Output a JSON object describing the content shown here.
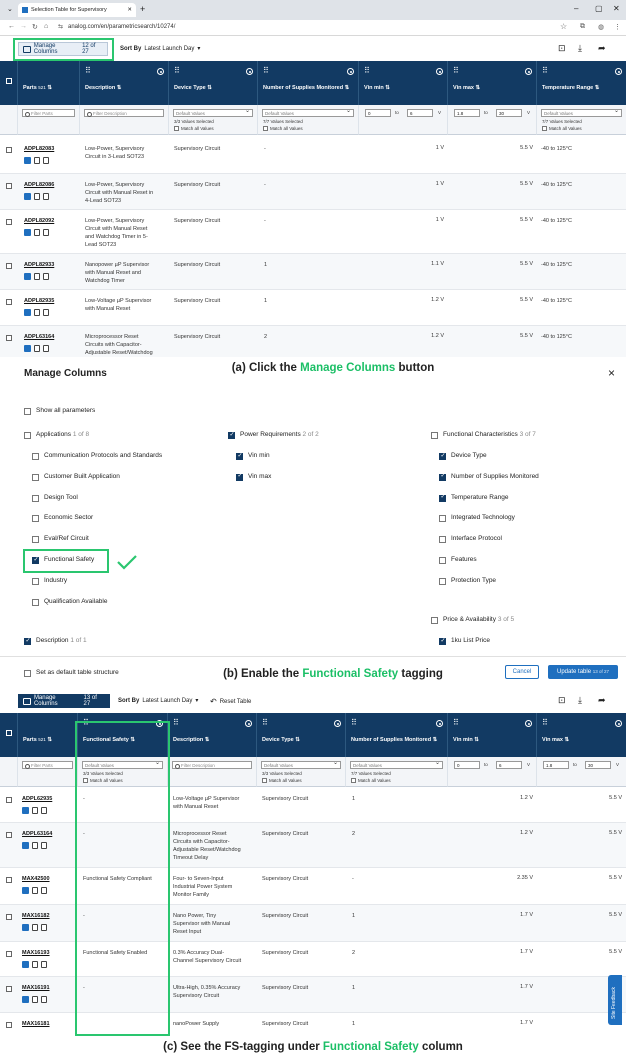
{
  "browser": {
    "tab_title": "Selection Table for Supervisory",
    "url": "analog.com/en/parametricsearch/10274/",
    "win_controls": [
      "–",
      "▢",
      "✕"
    ]
  },
  "panel_a": {
    "toolbar": {
      "manage_label": "Manage Columns",
      "manage_count": "12 of 27",
      "sort_label": "Sort By",
      "sort_value": "Latest Launch Day"
    },
    "headers": {
      "parts": "Parts",
      "parts_count": "521",
      "description": "Description",
      "device_type": "Device Type",
      "supplies": "Number of Supplies Monitored",
      "vin_min": "Vin min",
      "vin_max": "Vin max",
      "temp": "Temperature Range"
    },
    "filters": {
      "parts_ph": "Filter Parts",
      "desc_ph": "Filter Description",
      "default_values": "Default Values",
      "dev_sub": "3/3 Values Selected",
      "sup_sub": "7/7 Values Selected",
      "temp_sub": "7/7 Values Selected",
      "match_all": "Match all Values",
      "vmin_lo": "0",
      "vmin_hi": "6",
      "vmax_lo": "1.8",
      "vmax_hi": "30",
      "to": "to",
      "unit": "V"
    },
    "rows": [
      {
        "part": "ADPL82083",
        "desc": [
          "Low-Power, Supervisory",
          "Circuit in 3-Lead SOT23"
        ],
        "type": "Supervisory Circuit",
        "sup": "-",
        "vmin": "1 V",
        "vmax": "5.5 V",
        "temp": "-40 to 125°C"
      },
      {
        "part": "ADPL82086",
        "desc": [
          "Low-Power, Supervisory",
          "Circuit with Manual Reset in",
          "4-Lead SOT23"
        ],
        "type": "Supervisory Circuit",
        "sup": "-",
        "vmin": "1 V",
        "vmax": "5.5 V",
        "temp": "-40 to 125°C"
      },
      {
        "part": "ADPL82092",
        "desc": [
          "Low-Power, Supervisory",
          "Circuit with Manual Reset",
          "and Watchdog Timer in 5-",
          "Lead SOT23"
        ],
        "type": "Supervisory Circuit",
        "sup": "-",
        "vmin": "1 V",
        "vmax": "5.5 V",
        "temp": "-40 to 125°C"
      },
      {
        "part": "ADPL82933",
        "desc": [
          "Nanopower µP Supervisor",
          "with Manual Reset and",
          "Watchdog Timer"
        ],
        "type": "Supervisory Circuit",
        "sup": "1",
        "vmin": "1.1 V",
        "vmax": "5.5 V",
        "temp": "-40 to 125°C"
      },
      {
        "part": "ADPL82935",
        "desc": [
          "Low-Voltage µP Supervisor",
          "with Manual Reset"
        ],
        "type": "Supervisory Circuit",
        "sup": "1",
        "vmin": "1.2 V",
        "vmax": "5.5 V",
        "temp": "-40 to 125°C"
      },
      {
        "part": "ADPL63164",
        "desc": [
          "Microprocessor Reset",
          "Circuits with Capacitor-",
          "Adjustable Reset/Watchdog"
        ],
        "type": "Supervisory Circuit",
        "sup": "2",
        "vmin": "1.2 V",
        "vmax": "5.5 V",
        "temp": "-40 to 125°C"
      }
    ],
    "caption_prefix": "(a) Click the ",
    "caption_highlight": "Manage Columns",
    "caption_suffix": " button"
  },
  "panel_b": {
    "title": "Manage Columns",
    "close": "×",
    "show_all": "Show all parameters",
    "groups": {
      "applications": "Applications",
      "applications_count": "1 of 8",
      "power": "Power Requirements",
      "power_count": "2 of 2",
      "functional": "Functional Characteristics",
      "functional_count": "3 of 7",
      "price": "Price & Availability",
      "price_count": "3 of 5",
      "description": "Description",
      "description_count": "1 of 1"
    },
    "app_items": [
      "Communication Protocols and Standards",
      "Customer Built Application",
      "Design Tool",
      "Economic Sector",
      "Eval/Ref Circuit",
      "Functional Safety",
      "Industry",
      "Qualification Available"
    ],
    "power_items": [
      "Vin min",
      "Vin max"
    ],
    "func_items": [
      "Device Type",
      "Number of Supplies Monitored",
      "Temperature Range",
      "Integrated Technology",
      "Interface Protocol",
      "Features",
      "Protection Type"
    ],
    "price_items": [
      "1ku List Price"
    ],
    "set_default": "Set as default table structure",
    "cancel": "Cancel",
    "update": "Update table",
    "update_count": "13 of 27",
    "caption_prefix": "(b) Enable the ",
    "caption_highlight": "Functional Safety ",
    "caption_suffix": " tagging"
  },
  "panel_c": {
    "toolbar": {
      "manage_label": "Manage Columns",
      "manage_count": "13 of 27",
      "sort_label": "Sort By",
      "sort_value": "Latest Launch Day",
      "reset": "Reset Table"
    },
    "headers": {
      "parts": "Parts",
      "parts_count": "521",
      "fs": "Functional Safety",
      "description": "Description",
      "device_type": "Device Type",
      "supplies": "Number of Supplies Monitored",
      "vin_min": "Vin min",
      "vin_max": "Vin max"
    },
    "filters": {
      "fs_sub": "3/3 Values Selected",
      "default_values": "Default Values",
      "dev_sub": "3/3 Values Selected",
      "sup_sub": "7/7 Values Selected",
      "match_all": "Match all Values",
      "parts_ph": "Filter Parts",
      "desc_ph": "Filter Description",
      "vmin_lo": "0",
      "vmin_hi": "6",
      "vmax_lo": "1.8",
      "vmax_hi": "30",
      "to": "to",
      "unit": "V"
    },
    "rows": [
      {
        "part": "ADPL62935",
        "fs": "-",
        "desc": [
          "Low-Voltage µP Supervisor",
          "with Manual Reset"
        ],
        "type": "Supervisory Circuit",
        "sup": "1",
        "vmin": "1.2 V",
        "vmax": "5.5 V"
      },
      {
        "part": "ADPL63164",
        "fs": "-",
        "desc": [
          "Microprocessor Reset",
          "Circuits with Capacitor-",
          "Adjustable Reset/Watchdog",
          "Timeout Delay"
        ],
        "type": "Supervisory Circuit",
        "sup": "2",
        "vmin": "1.2 V",
        "vmax": "5.5 V"
      },
      {
        "part": "MAX42500",
        "fs": "Functional Safety Compliant",
        "desc": [
          "Four- to Seven-Input",
          "Industrial Power System",
          "Monitor Family"
        ],
        "type": "Supervisory Circuit",
        "sup": "-",
        "vmin": "2.35 V",
        "vmax": "5.5 V"
      },
      {
        "part": "MAX16182",
        "fs": "-",
        "desc": [
          "Nano Power, Tiny",
          "Supervisor with Manual",
          "Reset Input"
        ],
        "type": "Supervisory Circuit",
        "sup": "1",
        "vmin": "1.7 V",
        "vmax": "5.5 V"
      },
      {
        "part": "MAX16193",
        "fs": "Functional Safety Enabled",
        "desc": [
          "0.3% Accuracy Dual-",
          "Channel Supervisory Circuit"
        ],
        "type": "Supervisory Circuit",
        "sup": "2",
        "vmin": "1.7 V",
        "vmax": "5.5 V"
      },
      {
        "part": "MAX16191",
        "fs": "-",
        "desc": [
          "Ultra-High, 0.35% Accuracy",
          "Supervisory Circuit"
        ],
        "type": "Supervisory Circuit",
        "sup": "1",
        "vmin": "1.7 V",
        "vmax": "5.5 V"
      },
      {
        "part": "MAX16181",
        "fs": "",
        "desc": [
          "nanoPower Supply"
        ],
        "type": "Supervisory Circuit",
        "sup": "1",
        "vmin": "1.7 V",
        "vmax": ""
      }
    ],
    "site_feedback": "Site Feedback",
    "caption_prefix": "(c) See the FS-tagging under ",
    "caption_highlight": "Functional Safety",
    "caption_suffix": " column"
  }
}
